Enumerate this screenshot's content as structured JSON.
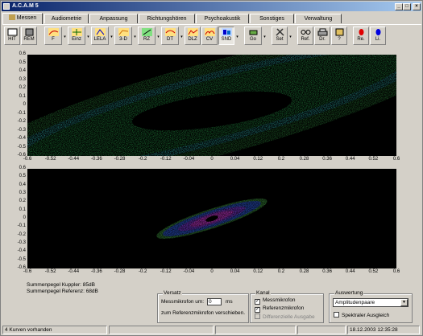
{
  "window": {
    "title": "A.C.A.M 5"
  },
  "tabs": [
    "Messen",
    "Audiometrie",
    "Anpassung",
    "Richtungshören",
    "Psychoakustik",
    "Sonstiges",
    "Verwaltung"
  ],
  "toolbar": {
    "hit": "HIT",
    "rem": "REM",
    "f": "F",
    "einz": "Einz",
    "lela": "LELA",
    "d3": "3-D",
    "rz": "RZ",
    "dt": "DT",
    "dlz": "DLZ",
    "cv": "CV",
    "snd": "SND",
    "go": "Go",
    "set": "Set",
    "ref": "Ref.",
    "dr": "Dr.",
    "help": "?",
    "re": "Re.",
    "li": "Li."
  },
  "axis": {
    "x_ticks": [
      "-0.6",
      "-0.52",
      "-0.44",
      "-0.36",
      "-0.28",
      "-0.2",
      "-0.12",
      "-0.04",
      "0",
      "0.04",
      "0.12",
      "0.2",
      "0.28",
      "0.36",
      "0.44",
      "0.52",
      "0.6"
    ],
    "y_ticks": [
      "0.6",
      "0.5",
      "0.4",
      "0.3",
      "0.2",
      "0.1",
      "0",
      "-0.1",
      "-0.2",
      "-0.3",
      "-0.4",
      "-0.5",
      "-0.6"
    ]
  },
  "summary": {
    "kuppler": "Summenpegel Kuppler: 85dB",
    "referenz": "Summenpegel Referenz: 68dB"
  },
  "versatz": {
    "title": "Versatz",
    "label1": "Messmikrofon um:",
    "value": "0",
    "unit": "ms",
    "label2": "zum Referenzmikrofon verschieben."
  },
  "kanal": {
    "title": "Kanal",
    "messmikrofon": "Messmikrofon",
    "referenzmikrofon": "Referenzmikrofon",
    "differenzielle": "Differenzielle Ausgabe"
  },
  "auswertung": {
    "title": "Auswertung",
    "selected": "Amplitudenpaare",
    "spektral": "Spektraler Ausgleich"
  },
  "status": {
    "curves": "4 Kurven vorhanden",
    "datetime": "18.12.2003 12:35:28"
  }
}
